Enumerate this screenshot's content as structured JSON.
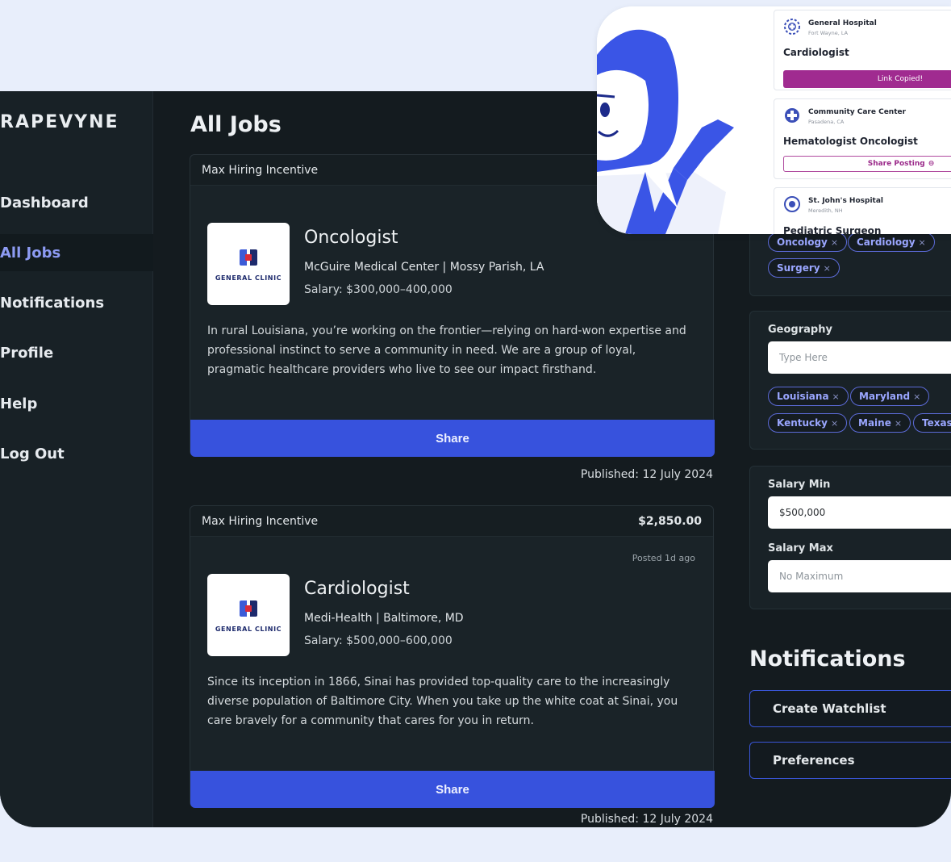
{
  "sidebar": {
    "brand": "RAPEVYNE",
    "items": [
      {
        "label": "Dashboard",
        "active": false
      },
      {
        "label": "All Jobs",
        "active": true
      },
      {
        "label": "Notifications",
        "active": false
      },
      {
        "label": "Profile",
        "active": false
      },
      {
        "label": "Help",
        "active": false
      },
      {
        "label": "Log Out",
        "active": false
      }
    ]
  },
  "main": {
    "title": "All Jobs",
    "jobs": [
      {
        "incentive_label": "Max Hiring Incentive",
        "incentive_amount": "",
        "posted": "",
        "logo_text": "GENERAL CLINIC",
        "title": "Oncologist",
        "org": "McGuire Medical Center | Mossy Parish, LA",
        "salary": "Salary: $300,000–400,000",
        "description": "In rural Louisiana, you’re working on the frontier—relying on hard-won expertise and professional instinct to serve a community in need. We are a group of loyal, pragmatic healthcare providers who live to see our impact firsthand.",
        "share_label": "Share",
        "published": "Published: 12 July 2024"
      },
      {
        "incentive_label": "Max Hiring Incentive",
        "incentive_amount": "$2,850.00",
        "posted": "Posted 1d ago",
        "logo_text": "GENERAL CLINIC",
        "title": "Cardiologist",
        "org": "Medi-Health | Baltimore, MD",
        "salary": "Salary: $500,000–600,000",
        "description": "Since its inception in 1866, Sinai has provided top-quality care to the increasingly diverse population of Baltimore City. When you take up the white coat at Sinai, you care bravely for a community that cares for you in return.",
        "share_label": "Share",
        "published": "Published: 12 July 2024"
      }
    ]
  },
  "filters": {
    "specialty_tags": [
      "Oncology",
      "Cardiology",
      "Surgery"
    ],
    "geography": {
      "label": "Geography",
      "placeholder": "Type Here",
      "tags": [
        "Louisiana",
        "Maryland",
        "Kentucky",
        "Maine",
        "Texas"
      ]
    },
    "salary_min": {
      "label": "Salary Min",
      "value": "$500,000"
    },
    "salary_max": {
      "label": "Salary Max",
      "placeholder": "No Maximum"
    },
    "tag_remove": "×"
  },
  "notifications": {
    "title": "Notifications",
    "create_watchlist": "Create Watchlist",
    "preferences": "Preferences"
  },
  "overlay": {
    "cards": [
      {
        "org": "General Hospital",
        "location": "Fort Wayne, LA",
        "title": "Cardiologist",
        "action": "Link Copied!"
      },
      {
        "org": "Community Care Center",
        "location": "Pasadena, CA",
        "title": "Hematologist Oncologist",
        "action": "Share Posting"
      },
      {
        "org": "St. John's Hospital",
        "location": "Meredith, NH",
        "title": "Pediatric Surgeon"
      }
    ]
  },
  "colors": {
    "accent": "#3752dd",
    "active_nav": "#8d9bf3",
    "copied": "#a02b90"
  }
}
